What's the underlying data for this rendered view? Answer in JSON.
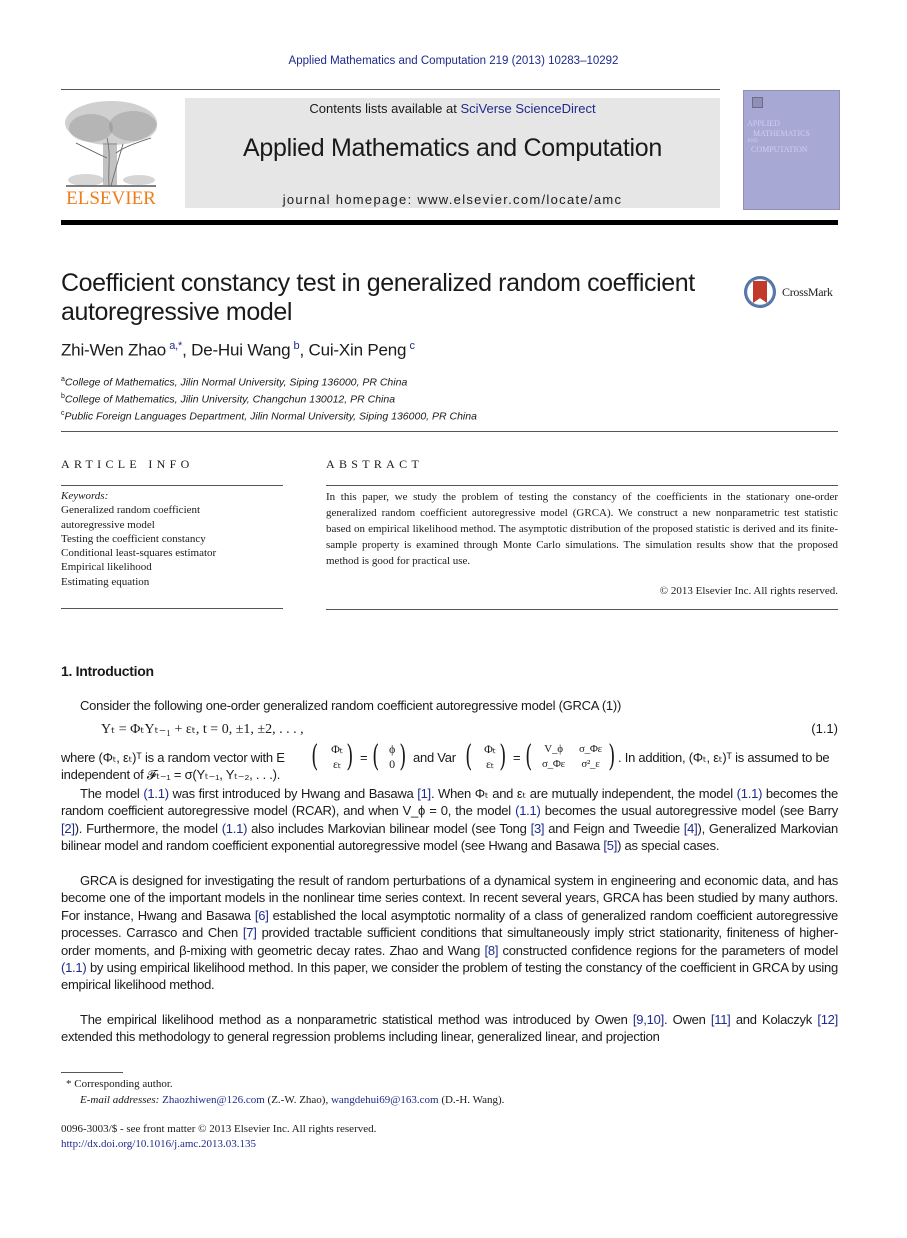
{
  "header": {
    "journal_reference": "Applied Mathematics and Computation 219 (2013) 10283–10292",
    "contents_prefix": "Contents lists available at ",
    "contents_link": "SciVerse ScienceDirect",
    "journal_title": "Applied Mathematics and Computation",
    "homepage_prefix": "journal homepage: ",
    "homepage_url": "www.elsevier.com/locate/amc",
    "publisher_logo_text": "ELSEVIER",
    "cover_lines": [
      "APPLIED",
      "MATHEMATICS",
      "AND",
      "COMPUTATION"
    ],
    "colors": {
      "link": "#1f2a8c",
      "elsevier_orange": "#ee7d1a",
      "cover": "#a8a8d4",
      "header_box": "#e6e6e6"
    }
  },
  "article": {
    "title": "Coefficient constancy test in generalized random coefficient autoregressive model",
    "crossmark_label": "CrossMark",
    "authors": [
      {
        "name": "Zhi-Wen Zhao",
        "sup": "a,*"
      },
      {
        "name": "De-Hui Wang",
        "sup": "b"
      },
      {
        "name": "Cui-Xin Peng",
        "sup": "c"
      }
    ],
    "affiliations": [
      {
        "mark": "a",
        "text": "College of Mathematics, Jilin Normal University, Siping 136000, PR China"
      },
      {
        "mark": "b",
        "text": "College of Mathematics, Jilin University, Changchun 130012, PR China"
      },
      {
        "mark": "c",
        "text": "Public Foreign Languages Department, Jilin Normal University, Siping 136000, PR China"
      }
    ]
  },
  "article_info": {
    "heading": "ARTICLE INFO",
    "keywords_label": "Keywords:",
    "keywords": [
      "Generalized random coefficient autoregressive model",
      "Testing the coefficient constancy",
      "Conditional least-squares estimator",
      "Empirical likelihood",
      "Estimating equation"
    ]
  },
  "abstract": {
    "heading": "ABSTRACT",
    "text": "In this paper, we study the problem of testing the constancy of the coefficients in the stationary one-order generalized random coefficient autoregressive model (GRCA). We construct a new nonparametric test statistic based on empirical likelihood method. The asymptotic distribution of the proposed statistic is derived and its finite-sample property is examined through Monte Carlo simulations. The simulation results show that the proposed method is good for practical use.",
    "copyright": "© 2013 Elsevier Inc. All rights reserved."
  },
  "introduction": {
    "heading": "1. Introduction",
    "para1": "Consider the following one-order generalized random coefficient autoregressive model (GRCA (1))",
    "equation": "Yₜ = ΦₜYₜ₋₁ + εₜ,    t = 0, ±1, ±2, . . . ,",
    "equation_number": "(1.1)",
    "where_parts": {
      "a": "where (Φₜ, εₜ)ᵀ is a random vector with E",
      "vec_top": "Φₜ",
      "vec_bottom": "εₜ",
      "mean_top": "ϕ",
      "mean_bottom": "0",
      "and_var": "and Var",
      "cov_11": "V_ϕ",
      "cov_12": "σ_Φε",
      "cov_21": "σ_Φε",
      "cov_22": "σ²_ε",
      "b": ". In addition, (Φₜ, εₜ)ᵀ is assumed to be"
    },
    "independent_line": "independent of 𝓕ₜ₋₁ = σ(Yₜ₋₁, Yₜ₋₂, . . .).",
    "para2": [
      {
        "t": "The model "
      },
      {
        "l": "(1.1)"
      },
      {
        "t": " was first introduced by Hwang and Basawa "
      },
      {
        "l": "[1]"
      },
      {
        "t": ". When Φₜ and εₜ are mutually independent, the model "
      },
      {
        "l": "(1.1)"
      },
      {
        "t": " becomes the random coefficient autoregressive model (RCAR), and when V_ϕ = 0, the model "
      },
      {
        "l": "(1.1)"
      },
      {
        "t": " becomes the usual autoregressive model (see Barry "
      },
      {
        "l": "[2]"
      },
      {
        "t": "). Furthermore, the model "
      },
      {
        "l": "(1.1)"
      },
      {
        "t": " also includes Markovian bilinear model (see Tong "
      },
      {
        "l": "[3]"
      },
      {
        "t": " and Feign and Tweedie "
      },
      {
        "l": "[4]"
      },
      {
        "t": "), Generalized Markovian bilinear model and random coefficient exponential autoregressive model (see Hwang and Basawa "
      },
      {
        "l": "[5]"
      },
      {
        "t": ") as special cases."
      }
    ],
    "para3": [
      {
        "t": "GRCA is designed for investigating the result of random perturbations of a dynamical system in engineering and economic data, and has become one of the important models in the nonlinear time series context. In recent several years, GRCA has been studied by many authors. For instance, Hwang and Basawa "
      },
      {
        "l": "[6]"
      },
      {
        "t": " established the local asymptotic normality of a class of generalized random coefficient autoregressive processes. Carrasco and Chen "
      },
      {
        "l": "[7]"
      },
      {
        "t": " provided tractable sufficient conditions that simultaneously imply strict stationarity, finiteness of higher-order moments, and β-mixing with geometric decay rates. Zhao and Wang "
      },
      {
        "l": "[8]"
      },
      {
        "t": " constructed confidence regions for the parameters of model "
      },
      {
        "l": "(1.1)"
      },
      {
        "t": " by using empirical likelihood method. In this paper, we consider the problem of testing the constancy of the coefficient in GRCA by using empirical likelihood method."
      }
    ],
    "para4": [
      {
        "t": "The empirical likelihood method as a nonparametric statistical method was introduced by Owen "
      },
      {
        "l": "[9,10]"
      },
      {
        "t": ". Owen "
      },
      {
        "l": "[11]"
      },
      {
        "t": " and Kolaczyk "
      },
      {
        "l": "[12]"
      },
      {
        "t": " extended this methodology to general regression problems including linear, generalized linear, and projection"
      }
    ]
  },
  "footnotes": {
    "corresponding": "* Corresponding author.",
    "email_label": "E-mail addresses:",
    "email1": "Zhaozhiwen@126.com",
    "email1_owner": " (Z.-W. Zhao), ",
    "email2": "wangdehui69@163.com",
    "email2_owner": " (D.-H. Wang).",
    "issn_line": "0096-3003/$ - see front matter © 2013 Elsevier Inc. All rights reserved.",
    "doi": "http://dx.doi.org/10.1016/j.amc.2013.03.135"
  }
}
